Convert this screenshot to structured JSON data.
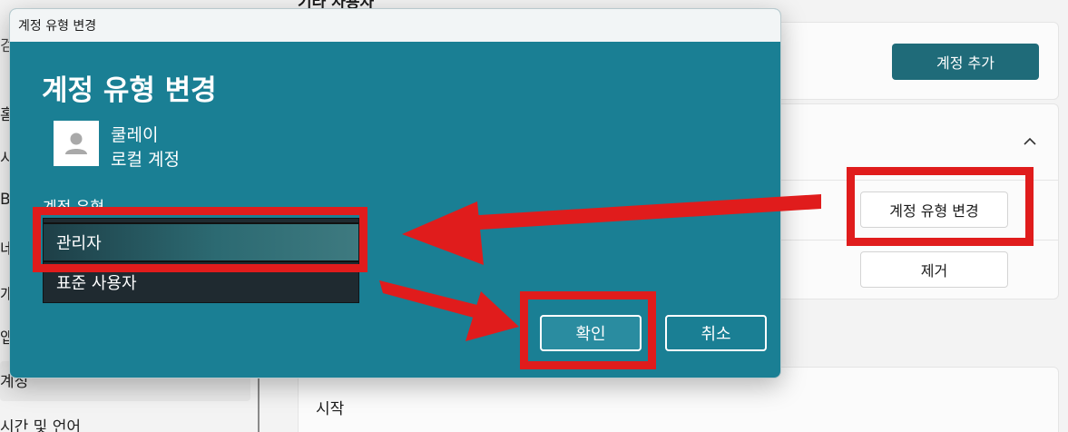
{
  "settings": {
    "section_title": "기타 사용자",
    "search_fragment": "검",
    "nav_fragments": [
      "홈",
      "시",
      "Bl",
      "네",
      "개",
      "앱"
    ],
    "nav_active": "계정",
    "nav_next": "시간 및 언어",
    "add_account_label": "계정 추가",
    "change_type_label": "계정 유형 변경",
    "remove_label": "제거",
    "start_label": "시작"
  },
  "dialog": {
    "window_title": "계정 유형 변경",
    "heading": "계정 유형 변경",
    "user_name": "쿨레이",
    "user_kind": "로컬 계정",
    "account_type_label": "계정 유형",
    "options": [
      {
        "label": "관리자",
        "selected": true
      },
      {
        "label": "표준 사용자",
        "selected": false
      }
    ],
    "ok_label": "확인",
    "cancel_label": "취소"
  },
  "icons": {
    "avatar": "person-icon",
    "expand": "chevron-up-icon"
  },
  "colors": {
    "dialog_bg": "#1a7f94",
    "accent_button": "#1f6b79",
    "annotation": "#e01c1c"
  }
}
